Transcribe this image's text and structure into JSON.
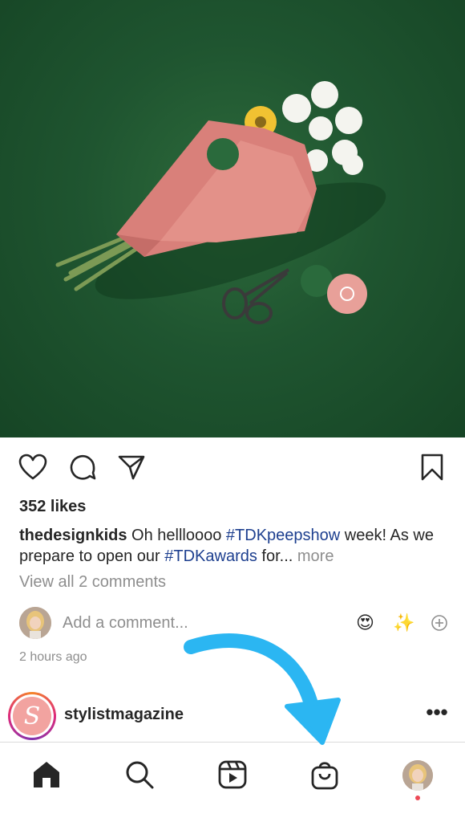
{
  "post": {
    "likes": "352 likes",
    "caption": {
      "username": "thedesignkids",
      "text_1": " Oh hellloooo ",
      "hashtag_1": "#TDKpeepshow",
      "text_2": " week! As we prepare to open our ",
      "hashtag_2": "#TDKawards",
      "text_3": " for... ",
      "more": "more"
    },
    "view_comments": "View all 2 comments",
    "add_comment_placeholder": "Add a comment...",
    "quick_emojis": [
      "😍",
      "✨"
    ],
    "time_ago": "2 hours ago"
  },
  "next_post": {
    "avatar_letter": "S",
    "username": "stylistmagazine",
    "options": "•••"
  },
  "icons": {
    "like": "heart-icon",
    "comment": "comment-icon",
    "share": "send-icon",
    "save": "bookmark-icon",
    "add": "plus-circle-icon",
    "home": "home-icon",
    "search": "search-icon",
    "reels": "reels-icon",
    "shop": "shopping-bag-icon"
  },
  "colors": {
    "hashtag": "#1d3f8f",
    "arrow_annotation": "#2bb6f2",
    "notification_dot": "#ed4956",
    "secondary_text": "#8e8e8e"
  }
}
